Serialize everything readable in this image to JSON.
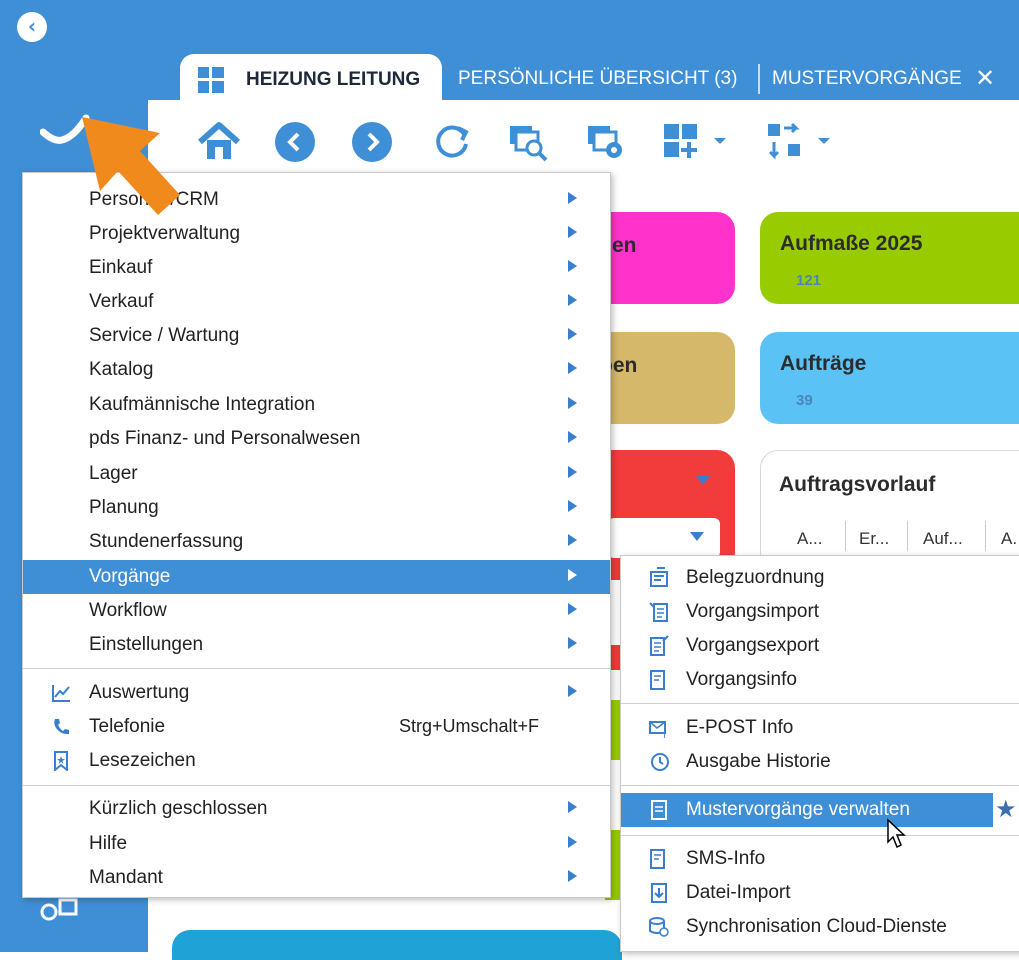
{
  "tabs": [
    {
      "label": "HEIZUNG LEITUNG",
      "active": true
    },
    {
      "label": "PERSÖNLICHE ÜBERSICHT (3)",
      "active": false
    },
    {
      "label": "MUSTERVORGÄNGE",
      "active": false,
      "closable": true
    }
  ],
  "toolbar": {
    "icons": [
      "home-icon",
      "back-icon",
      "forward-icon",
      "refresh-icon",
      "search-window-icon",
      "settings-window-icon",
      "add-widget-icon",
      "sort-icon"
    ]
  },
  "tiles": [
    {
      "title": "Aufmaße 2025",
      "count": "121",
      "color": "#99cc00"
    },
    {
      "title": "Aufträge",
      "count": "39",
      "color": "#5bc2f5"
    }
  ],
  "peek": {
    "tile_magenta_partial": "en",
    "tile_tan_partial": "pen"
  },
  "auftragsvorlauf": {
    "title": "Auftragsvorlauf",
    "columns": [
      "A...",
      "Er...",
      "Auf...",
      "A."
    ]
  },
  "menu": {
    "items": [
      {
        "label": "Personen/CRM",
        "submenu": true
      },
      {
        "label": "Projektverwaltung",
        "submenu": true
      },
      {
        "label": "Einkauf",
        "submenu": true
      },
      {
        "label": "Verkauf",
        "submenu": true
      },
      {
        "label": "Service / Wartung",
        "submenu": true
      },
      {
        "label": "Katalog",
        "submenu": true
      },
      {
        "label": "Kaufmännische Integration",
        "submenu": true
      },
      {
        "label": "pds Finanz- und Personalwesen",
        "submenu": true
      },
      {
        "label": "Lager",
        "submenu": true
      },
      {
        "label": "Planung",
        "submenu": true
      },
      {
        "label": "Stundenerfassung",
        "submenu": true
      },
      {
        "label": "Vorgänge",
        "submenu": true,
        "selected": true
      },
      {
        "label": "Workflow",
        "submenu": true
      },
      {
        "label": "Einstellungen",
        "submenu": true
      }
    ],
    "tools": [
      {
        "label": "Auswertung",
        "icon": "chart-icon",
        "submenu": true
      },
      {
        "label": "Telefonie",
        "icon": "phone-icon",
        "shortcut": "Strg+Umschalt+F"
      },
      {
        "label": "Lesezeichen",
        "icon": "bookmark-icon"
      }
    ],
    "footer": [
      {
        "label": "Kürzlich geschlossen",
        "submenu": true
      },
      {
        "label": "Hilfe",
        "submenu": true
      },
      {
        "label": "Mandant",
        "submenu": true
      }
    ]
  },
  "submenu": {
    "group1": [
      {
        "label": "Belegzuordnung",
        "icon": "document-assign-icon"
      },
      {
        "label": "Vorgangsimport",
        "icon": "document-import-icon"
      },
      {
        "label": "Vorgangsexport",
        "icon": "document-export-icon"
      },
      {
        "label": "Vorgangsinfo",
        "icon": "document-info-icon"
      }
    ],
    "group2": [
      {
        "label": "E-POST Info",
        "icon": "email-info-icon"
      },
      {
        "label": "Ausgabe Historie",
        "icon": "history-icon"
      }
    ],
    "group3": [
      {
        "label": "Mustervorgänge verwalten",
        "icon": "template-document-icon",
        "selected": true
      }
    ],
    "group4": [
      {
        "label": "SMS-Info",
        "icon": "sms-info-icon"
      },
      {
        "label": "Datei-Import",
        "icon": "file-import-icon"
      },
      {
        "label": "Synchronisation Cloud-Dienste",
        "icon": "cloud-sync-icon"
      }
    ]
  },
  "colors": {
    "brand_blue": "#3f8fd6",
    "highlight_orange": "#f08a1c",
    "tile_magenta": "#ff33cc",
    "tile_tan": "#d6b86a",
    "tile_red": "#f23c3c"
  }
}
